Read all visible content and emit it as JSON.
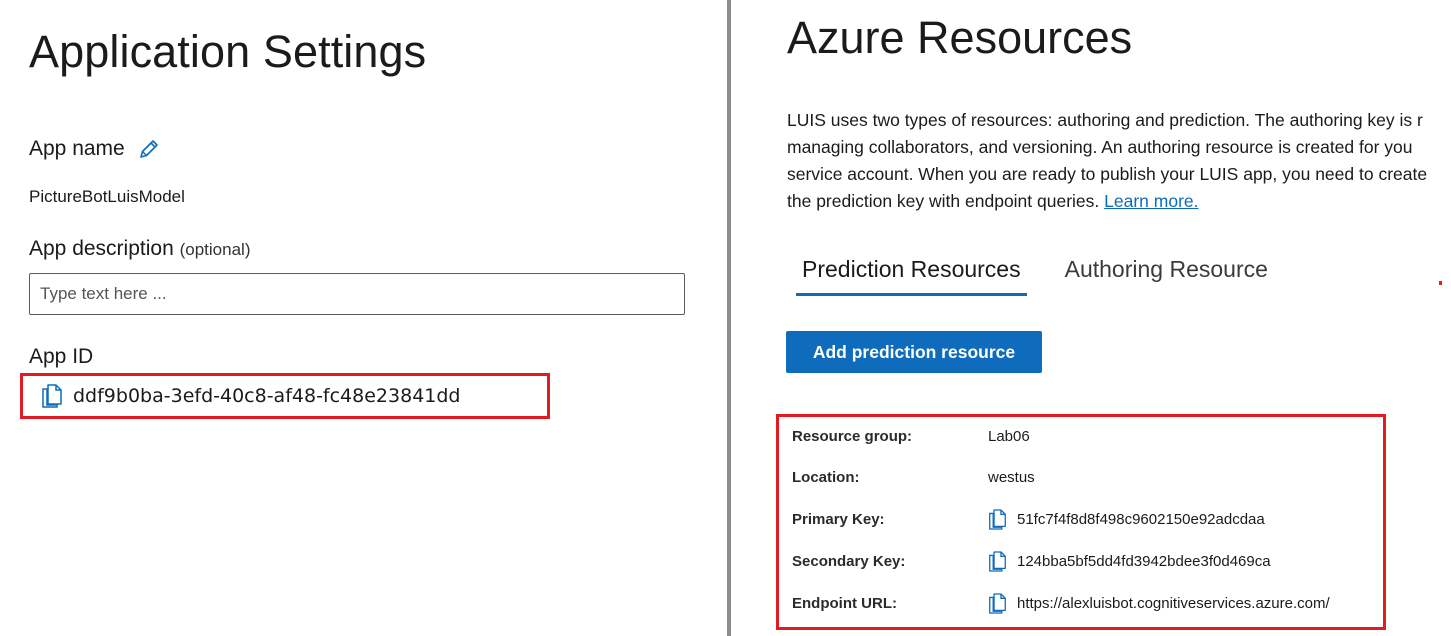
{
  "left": {
    "title": "Application Settings",
    "app_name_label": "App name",
    "app_name_value": "PictureBotLuisModel",
    "description_label": "App description",
    "description_optional": "(optional)",
    "description_placeholder": "Type text here ...",
    "description_value": "",
    "app_id_label": "App ID",
    "app_id_value": "ddf9b0ba-3efd-40c8-af48-fc48e23841dd"
  },
  "right": {
    "title": "Azure Resources",
    "intro_lines": [
      "LUIS uses two types of resources: authoring and prediction. The authoring key is r",
      "managing collaborators, and versioning. An authoring resource is created for you",
      "service account. When you are ready to publish your LUIS app, you need to create",
      "the prediction key with endpoint queries."
    ],
    "learn_more": "Learn more.",
    "tabs": [
      {
        "label": "Prediction Resources",
        "active": true
      },
      {
        "label": "Authoring Resource",
        "active": false
      }
    ],
    "add_button": "Add prediction resource",
    "resource": {
      "rows": [
        {
          "key": "Resource group:",
          "value": "Lab06",
          "copyable": false
        },
        {
          "key": "Location:",
          "value": "westus",
          "copyable": false
        },
        {
          "key": "Primary Key:",
          "value": "51fc7f4f8d8f498c9602150e92adcdaa",
          "copyable": true
        },
        {
          "key": "Secondary Key:",
          "value": "124bba5bf5dd4fd3942bdee3f0d469ca",
          "copyable": true
        },
        {
          "key": "Endpoint URL:",
          "value": "https://alexluisbot.cognitiveservices.azure.com/",
          "copyable": true
        }
      ]
    }
  },
  "colors": {
    "accent": "#0f6cbd",
    "highlight": "#e21b23",
    "divider": "#8c8c8c"
  },
  "icons": {
    "edit": "pencil-icon",
    "copy": "copy-icon"
  }
}
